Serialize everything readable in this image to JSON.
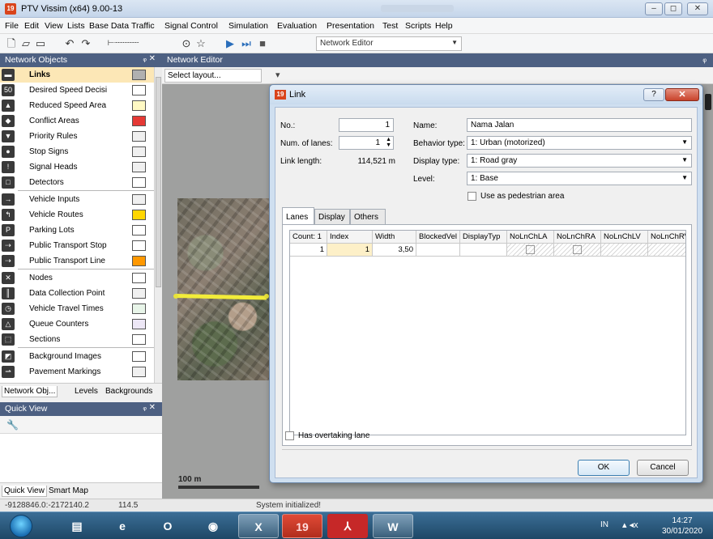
{
  "window": {
    "title": "PTV Vissim (x64) 9.00-13",
    "minimize_glyph": "–",
    "restore_glyph": "◻",
    "close_glyph": "✕"
  },
  "menu": [
    "File",
    "Edit",
    "View",
    "Lists",
    "Base Data",
    "Traffic",
    "Signal Control",
    "Simulation",
    "Evaluation",
    "Presentation",
    "Test",
    "Scripts",
    "Help"
  ],
  "toolbar": {
    "editor_combo": "Network Editor"
  },
  "network_objects": {
    "title": "Network Objects",
    "pin_glyph": "ᵩ ✕",
    "items": [
      {
        "label": "Links",
        "icon": "links-icon",
        "glyph": "▬",
        "swatch": "#b0b0b0",
        "selected": true
      },
      {
        "label": "Desired Speed Decisi",
        "icon": "speed-sign-icon",
        "glyph": "50",
        "swatch": "#ffffff"
      },
      {
        "label": "Reduced Speed Area",
        "icon": "reduced-speed-icon",
        "glyph": "▲",
        "swatch": "#fff9c4"
      },
      {
        "label": "Conflict Areas",
        "icon": "conflict-areas-icon",
        "glyph": "◆",
        "swatch": "#e53935"
      },
      {
        "label": "Priority Rules",
        "icon": "priority-rules-icon",
        "glyph": "▼",
        "swatch": "#f0f0f0"
      },
      {
        "label": "Stop Signs",
        "icon": "stop-sign-icon",
        "glyph": "●",
        "swatch": "#f0f0f0"
      },
      {
        "label": "Signal Heads",
        "icon": "signal-head-icon",
        "glyph": "!",
        "swatch": "#f0f0f0"
      },
      {
        "label": "Detectors",
        "icon": "detector-icon",
        "glyph": "□",
        "swatch": "#ffffff"
      },
      {
        "label": "Vehicle Inputs",
        "icon": "vehicle-input-icon",
        "glyph": "→",
        "swatch": "#f0f0f0"
      },
      {
        "label": "Vehicle Routes",
        "icon": "vehicle-routes-icon",
        "glyph": "↰",
        "swatch": "#ffd600"
      },
      {
        "label": "Parking Lots",
        "icon": "parking-icon",
        "glyph": "P",
        "swatch": "#ffffff"
      },
      {
        "label": "Public Transport Stop",
        "icon": "pt-stop-icon",
        "glyph": "⇢",
        "swatch": "#ffffff"
      },
      {
        "label": "Public Transport Line",
        "icon": "pt-line-icon",
        "glyph": "⇢",
        "swatch": "#ff9800"
      },
      {
        "label": "Nodes",
        "icon": "nodes-icon",
        "glyph": "✕",
        "swatch": "#ffffff"
      },
      {
        "label": "Data Collection Point",
        "icon": "data-collection-icon",
        "glyph": "║",
        "swatch": "#f0f0f0"
      },
      {
        "label": "Vehicle Travel Times",
        "icon": "travel-times-icon",
        "glyph": "◷",
        "swatch": "#e8f5e9"
      },
      {
        "label": "Queue Counters",
        "icon": "queue-counter-icon",
        "glyph": "△",
        "swatch": "#ede7f6"
      },
      {
        "label": "Sections",
        "icon": "sections-icon",
        "glyph": "⬚",
        "swatch": "#ffffff"
      },
      {
        "label": "Background Images",
        "icon": "background-images-icon",
        "glyph": "◩",
        "swatch": "#ffffff"
      },
      {
        "label": "Pavement Markings",
        "icon": "pavement-markings-icon",
        "glyph": "⇀",
        "swatch": "#f0f0f0"
      }
    ],
    "tabs": [
      "Network Obj...",
      "Levels",
      "Backgrounds"
    ]
  },
  "quick_view": {
    "title": "Quick View",
    "pin_glyph": "ᵩ ✕",
    "tabs": [
      "Quick View",
      "Smart Map"
    ]
  },
  "network_editor": {
    "title": "Network Editor",
    "layout_combo": "Select layout...",
    "scale_label": "100 m"
  },
  "status": {
    "coords": "-9128846.0:-2172140.2",
    "zoom": "114.5",
    "message": "System initialized!"
  },
  "dialog": {
    "title": "Link",
    "help_glyph": "?",
    "close_glyph": "✕",
    "fields": {
      "no_label": "No.:",
      "no_value": "1",
      "lanes_label": "Num. of lanes:",
      "lanes_value": "1",
      "length_label": "Link length:",
      "length_value": "114,521 m",
      "name_label": "Name:",
      "name_value": "Nama Jalan",
      "behavior_label": "Behavior type:",
      "behavior_value": "1: Urban (motorized)",
      "display_label": "Display type:",
      "display_value": "1: Road gray",
      "level_label": "Level:",
      "level_value": "1: Base",
      "pedestrian_label": "Use as pedestrian area"
    },
    "tabs": [
      "Lanes",
      "Display",
      "Others"
    ],
    "grid": {
      "headers": [
        "Count: 1",
        "Index",
        "Width",
        "BlockedVel",
        "DisplayTyp",
        "NoLnChLA",
        "NoLnChRA",
        "NoLnChLV",
        "NoLnChRV"
      ],
      "rows": [
        [
          "1",
          "1",
          "3,50",
          "",
          "",
          "",
          "",
          "",
          ""
        ]
      ]
    },
    "overtaking_label": "Has overtaking lane",
    "ok_label": "OK",
    "cancel_label": "Cancel"
  },
  "taskbar": {
    "lang": "IN",
    "time": "14:27",
    "date": "30/01/2020",
    "apps": [
      "explorer",
      "ie",
      "outlook",
      "firefox",
      "excel",
      "vissim",
      "acrobat",
      "word"
    ]
  }
}
